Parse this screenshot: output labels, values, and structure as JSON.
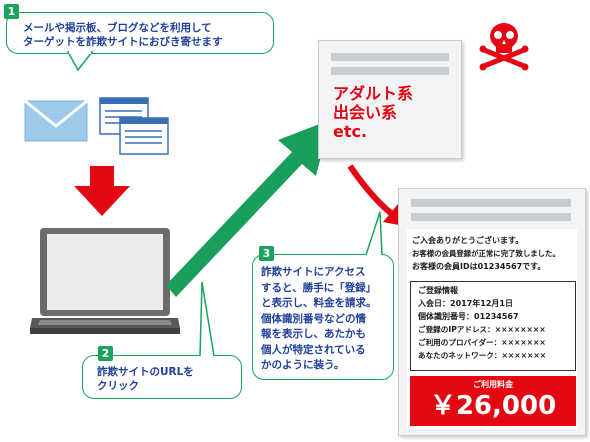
{
  "steps": [
    {
      "number": "1",
      "lines": [
        "メールや掲示板、ブログなどを利用して",
        "ターゲットを詐欺サイトにおびき寄せます"
      ]
    },
    {
      "number": "2",
      "lines": [
        "詐欺サイトのURLを",
        "クリック"
      ]
    },
    {
      "number": "3",
      "lines": [
        "詐欺サイトにアクセス",
        "すると、勝手に「登録」",
        "と表示し、料金を請求。",
        "個体識別番号などの情",
        "報を表示し、あたかも",
        "個人が特定されている",
        "かのように装う。"
      ]
    }
  ],
  "site_categories": [
    "アダルト系",
    "出会い系",
    "etc."
  ],
  "registration_page": {
    "greeting_lines": [
      "ご入会ありがとうございます。",
      "お客様の会員登録が正常に完了致しました。",
      "お客様の会員IDは01234567です。"
    ],
    "info_title": "ご登録情報",
    "info_lines": [
      "入会日：2017年12月1日",
      "個体識別番号：01234567",
      "ご登録のIPアドレス：××××××××",
      "ご利用のプロバイダー：×××××××",
      "あなたのネットワーク：×××××××"
    ],
    "fee_label": "ご利用料金",
    "fee_amount": "￥26,000"
  },
  "colors": {
    "callout_border": "#19a35b",
    "callout_text": "#1f3f9a",
    "warning_red": "#e30613",
    "arrow_green": "#1a9e5c",
    "laptop_gray": "#6b6b6b",
    "envelope_blue": "#9dc9ea"
  },
  "icons": [
    "envelope-icon",
    "browser-window-icon",
    "laptop-icon",
    "skull-crossbones-icon"
  ]
}
